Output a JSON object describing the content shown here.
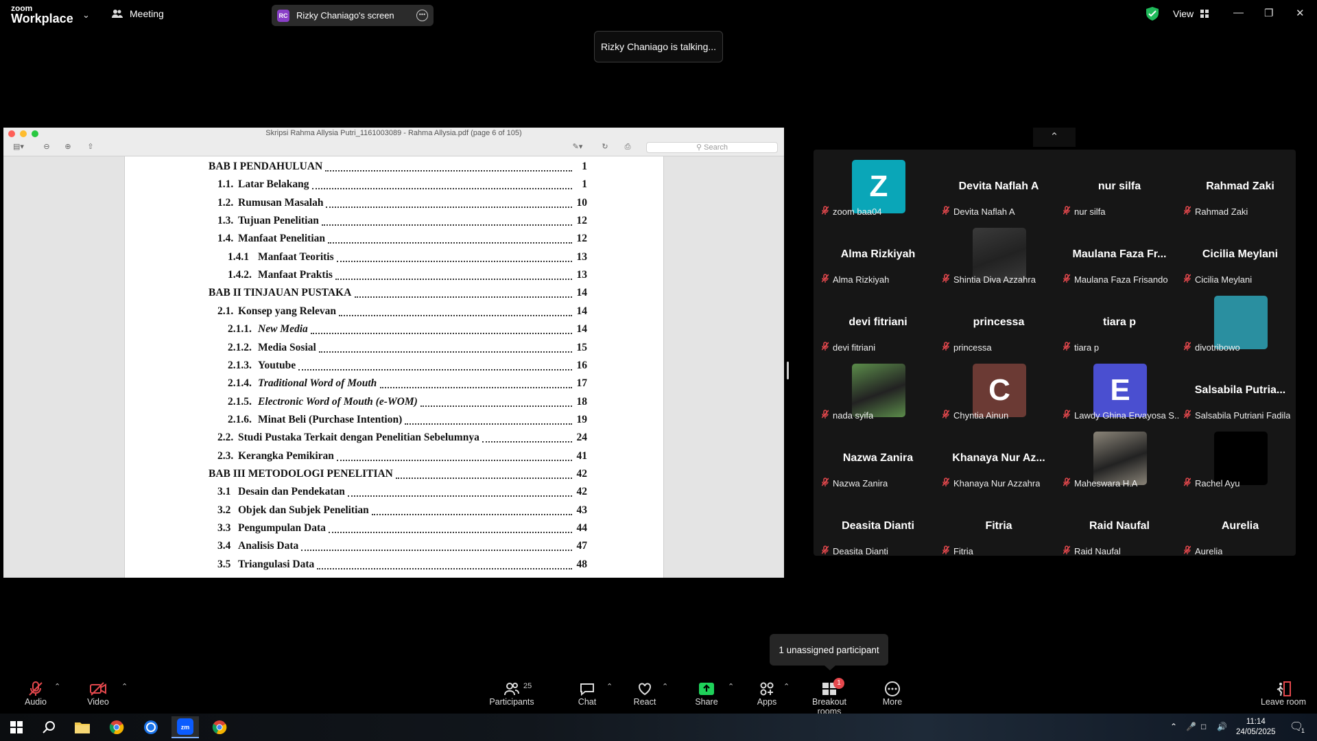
{
  "app": {
    "logo_line1": "zoom",
    "logo_line2": "Workplace",
    "meeting_label": "Meeting",
    "share_initials": "RC",
    "share_label": "Rizky Chaniago's screen",
    "view_label": "View",
    "talking_notice": "Rizky Chaniago is talking...",
    "accent": "#0b5cff",
    "mic_off_color": "#e5484d"
  },
  "pdf": {
    "window_title": "Skripsi Rahma Allysia Putri_1161003089 - Rahma Allysia.pdf (page 6 of 105)",
    "search_placeholder": "Search",
    "toc": [
      {
        "num": "",
        "title": "BAB I PENDAHULUAN",
        "page": "1",
        "level": 0,
        "italic": false
      },
      {
        "num": "1.1.",
        "title": "Latar Belakang",
        "page": "1",
        "level": 1,
        "italic": false
      },
      {
        "num": "1.2.",
        "title": "Rumusan Masalah",
        "page": "10",
        "level": 1,
        "italic": false
      },
      {
        "num": "1.3.",
        "title": "Tujuan Penelitian",
        "page": "12",
        "level": 1,
        "italic": false
      },
      {
        "num": "1.4.",
        "title": "Manfaat Penelitian",
        "page": "12",
        "level": 1,
        "italic": false
      },
      {
        "num": "1.4.1",
        "title": "Manfaat Teoritis",
        "page": "13",
        "level": 2,
        "italic": false
      },
      {
        "num": "1.4.2.",
        "title": "Manfaat Praktis",
        "page": "13",
        "level": 2,
        "italic": false
      },
      {
        "num": "",
        "title": "BAB II TINJAUAN PUSTAKA",
        "page": "14",
        "level": 0,
        "italic": false
      },
      {
        "num": "2.1.",
        "title": "Konsep yang Relevan",
        "page": "14",
        "level": 1,
        "italic": false
      },
      {
        "num": "2.1.1.",
        "title": "New Media",
        "page": "14",
        "level": 2,
        "italic": true
      },
      {
        "num": "2.1.2.",
        "title": "Media Sosial",
        "page": "15",
        "level": 2,
        "italic": false
      },
      {
        "num": "2.1.3.",
        "title": "Youtube",
        "page": "16",
        "level": 2,
        "italic": false
      },
      {
        "num": "2.1.4.",
        "title": "Traditional Word of Mouth",
        "page": "17",
        "level": 2,
        "italic": true
      },
      {
        "num": "2.1.5.",
        "title": "Electronic Word of Mouth (e-WOM)",
        "page": "18",
        "level": 2,
        "italic": true
      },
      {
        "num": "2.1.6.",
        "title": "Minat Beli (Purchase Intention)",
        "page": "19",
        "level": 2,
        "italic": false
      },
      {
        "num": "2.2.",
        "title": "Studi Pustaka Terkait dengan Penelitian Sebelumnya",
        "page": "24",
        "level": 1,
        "italic": false
      },
      {
        "num": "2.3.",
        "title": "Kerangka Pemikiran",
        "page": "41",
        "level": 1,
        "italic": false
      },
      {
        "num": "",
        "title": "BAB III METODOLOGI PENELITIAN",
        "page": "42",
        "level": 0,
        "italic": false
      },
      {
        "num": "3.1",
        "title": "Desain dan Pendekatan",
        "page": "42",
        "level": 1,
        "italic": false
      },
      {
        "num": "3.2",
        "title": "Objek dan Subjek Penelitian",
        "page": "43",
        "level": 1,
        "italic": false
      },
      {
        "num": "3.3",
        "title": "Pengumpulan Data",
        "page": "44",
        "level": 1,
        "italic": false
      },
      {
        "num": "3.4",
        "title": "Analisis Data",
        "page": "47",
        "level": 1,
        "italic": false
      },
      {
        "num": "3.5",
        "title": "Triangulasi Data",
        "page": "48",
        "level": 1,
        "italic": false
      }
    ]
  },
  "participants": [
    {
      "big": "",
      "avatar": "Z",
      "avatar_color": "#0aa6b8",
      "label": "zoom baa04"
    },
    {
      "big": "Devita Naflah A",
      "avatar": "",
      "label": "Devita Naflah A"
    },
    {
      "big": "nur silfa",
      "avatar": "",
      "label": "nur silfa"
    },
    {
      "big": "Rahmad Zaki",
      "avatar": "",
      "label": "Rahmad Zaki"
    },
    {
      "big": "Alma Rizkiyah",
      "avatar": "",
      "label": "Alma Rizkiyah"
    },
    {
      "big": "",
      "avatar": "photo-dark",
      "avatar_color": "#3a3a3a",
      "label": "Shintia Diva Azzahra"
    },
    {
      "big": "Maulana Faza Fr...",
      "avatar": "",
      "label": "Maulana Faza Frisando"
    },
    {
      "big": "Cicilia Meylani",
      "avatar": "",
      "label": "Cicilia Meylani"
    },
    {
      "big": "devi fitriani",
      "avatar": "",
      "label": "devi fitriani"
    },
    {
      "big": "princessa",
      "avatar": "",
      "label": "princessa"
    },
    {
      "big": "tiara p",
      "avatar": "",
      "label": "tiara p"
    },
    {
      "big": "",
      "avatar": "plain",
      "avatar_color": "#2a8fa0",
      "label": "divotribowo"
    },
    {
      "big": "",
      "avatar": "photo-green",
      "avatar_color": "#5b8c4a",
      "label": "nada syifa"
    },
    {
      "big": "",
      "avatar": "C",
      "avatar_color": "#6b3a34",
      "label": "Chyntia Ainun"
    },
    {
      "big": "",
      "avatar": "E",
      "avatar_color": "#4a4fd0",
      "label": "Lawdy Ghina Ervayosa S..."
    },
    {
      "big": "Salsabila Putria...",
      "avatar": "",
      "label": "Salsabila Putriani Fadila"
    },
    {
      "big": "Nazwa Zanira",
      "avatar": "",
      "label": "Nazwa Zanira"
    },
    {
      "big": "Khanaya Nur Az...",
      "avatar": "",
      "label": "Khanaya Nur Azzahra"
    },
    {
      "big": "",
      "avatar": "photo-gray",
      "avatar_color": "#8a8478",
      "label": "Maheswara H.A"
    },
    {
      "big": "",
      "avatar": "plain",
      "avatar_color": "#000000",
      "label": "Rachel Ayu"
    },
    {
      "big": "Deasita Dianti",
      "avatar": "",
      "label": "Deasita Dianti"
    },
    {
      "big": "Fitria",
      "avatar": "",
      "label": "Fitria"
    },
    {
      "big": "Raid Naufal",
      "avatar": "",
      "label": "Raid Naufal"
    },
    {
      "big": "Aurelia",
      "avatar": "",
      "label": "Aurelia"
    }
  ],
  "unassigned_tooltip": "1 unassigned participant",
  "toolbar": {
    "audio": "Audio",
    "video": "Video",
    "participants": "Participants",
    "participants_count": "25",
    "chat": "Chat",
    "react": "React",
    "share": "Share",
    "apps": "Apps",
    "breakout": "Breakout rooms",
    "breakout_badge": "1",
    "more": "More",
    "leave": "Leave room",
    "share_color": "#1fd15a"
  },
  "taskbar": {
    "time": "11:14",
    "date": "24/05/2025",
    "notif_count": "1"
  }
}
